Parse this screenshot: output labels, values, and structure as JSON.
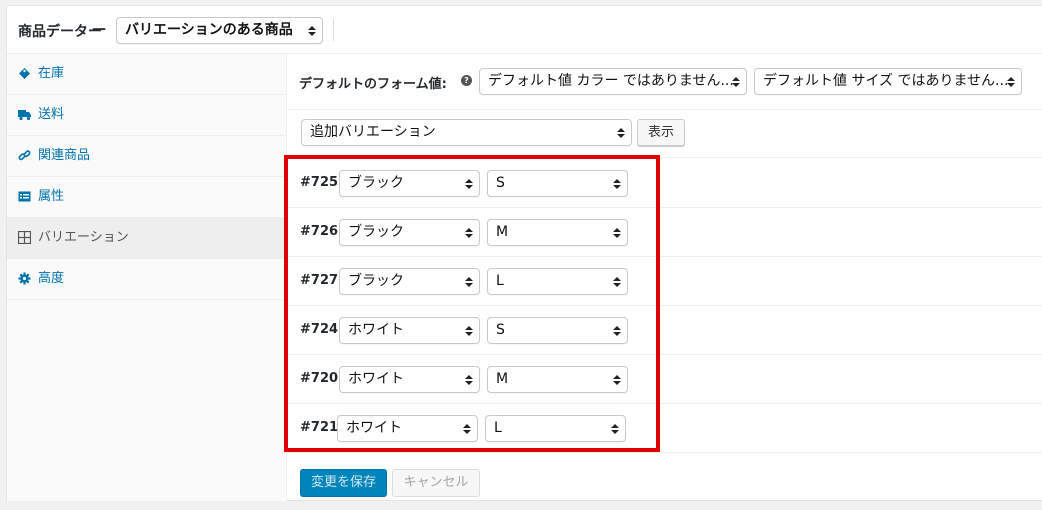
{
  "header": {
    "title": "商品データー",
    "dash": "—",
    "product_type": "バリエーションのある商品"
  },
  "sidebar": {
    "items": [
      {
        "label": "在庫",
        "icon": "tag-icon"
      },
      {
        "label": "送料",
        "icon": "truck-icon"
      },
      {
        "label": "関連商品",
        "icon": "link-icon"
      },
      {
        "label": "属性",
        "icon": "list-icon"
      },
      {
        "label": "バリエーション",
        "icon": "grid-icon"
      },
      {
        "label": "高度",
        "icon": "gear-icon"
      }
    ]
  },
  "defaults": {
    "label": "デフォルトのフォーム値:",
    "help": "?",
    "color_select": "デフォルト値 カラー ではありません...",
    "size_select": "デフォルト値 サイズ ではありません..."
  },
  "add": {
    "select": "追加バリエーション",
    "button": "表示"
  },
  "variations": [
    {
      "id": "#725",
      "color": "ブラック",
      "size": "S"
    },
    {
      "id": "#726",
      "color": "ブラック",
      "size": "M"
    },
    {
      "id": "#727",
      "color": "ブラック",
      "size": "L"
    },
    {
      "id": "#724",
      "color": "ホワイト",
      "size": "S"
    },
    {
      "id": "#720",
      "color": "ホワイト",
      "size": "M"
    },
    {
      "id": "#721",
      "color": "ホワイト",
      "size": "L"
    }
  ],
  "footer": {
    "save": "変更を保存",
    "cancel": "キャンセル"
  },
  "colors": {
    "link": "#0073aa",
    "primary": "#0085ba",
    "highlight": "#e00000"
  }
}
